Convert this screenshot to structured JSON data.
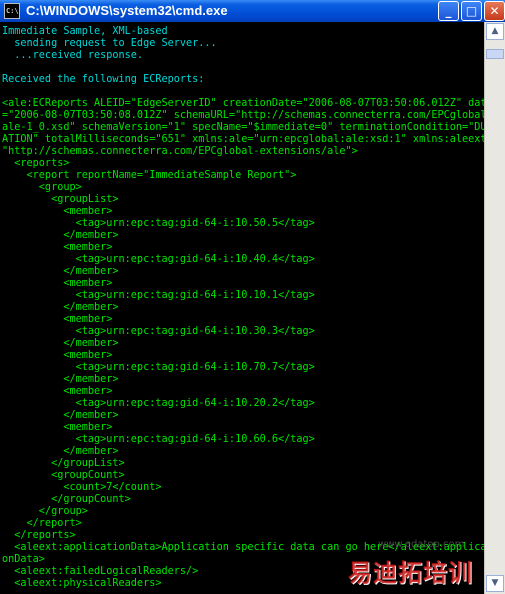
{
  "window": {
    "title": "C:\\WINDOWS\\system32\\cmd.exe",
    "icon_text": "C:\\",
    "buttons": {
      "minimize": "_",
      "maximize": "□",
      "close": "✕"
    }
  },
  "console": {
    "lines": [
      {
        "text": "Immediate Sample, XML-based",
        "color": "#00d8d8"
      },
      {
        "text": "  sending request to Edge Server...",
        "color": "#00d8d8"
      },
      {
        "text": "  ...received response.",
        "color": "#00d8d8"
      },
      {
        "text": "",
        "color": "#c0c0c0"
      },
      {
        "text": "Received the following ECReports:",
        "color": "#00d8d8"
      },
      {
        "text": "",
        "color": "#c0c0c0"
      },
      {
        "text": "<ale:ECReports ALEID=\"EdgeServerID\" creationDate=\"2006-08-07T03:50:06.012Z\" date",
        "color": "#00e400"
      },
      {
        "text": "=\"2006-08-07T03:50:08.012Z\" schemaURL=\"http://schemas.connecterra.com/EPCglobal/",
        "color": "#00e400"
      },
      {
        "text": "ale-1_0.xsd\" schemaVersion=\"1\" specName=\"$immediate=0\" terminationCondition=\"DUR",
        "color": "#00e400"
      },
      {
        "text": "ATION\" totalMilliseconds=\"651\" xmlns:ale=\"urn:epcglobal:ale:xsd:1\" xmlns:aleext=",
        "color": "#00e400"
      },
      {
        "text": "\"http://schemas.connecterra.com/EPCglobal-extensions/ale\">",
        "color": "#00e400"
      },
      {
        "text": "  <reports>",
        "color": "#00e400"
      },
      {
        "text": "    <report reportName=\"ImmediateSample Report\">",
        "color": "#00e400"
      },
      {
        "text": "      <group>",
        "color": "#00e400"
      },
      {
        "text": "        <groupList>",
        "color": "#00e400"
      },
      {
        "text": "          <member>",
        "color": "#00e400"
      },
      {
        "text": "            <tag>urn:epc:tag:gid-64-i:10.50.5</tag>",
        "color": "#00e400"
      },
      {
        "text": "          </member>",
        "color": "#00e400"
      },
      {
        "text": "          <member>",
        "color": "#00e400"
      },
      {
        "text": "            <tag>urn:epc:tag:gid-64-i:10.40.4</tag>",
        "color": "#00e400"
      },
      {
        "text": "          </member>",
        "color": "#00e400"
      },
      {
        "text": "          <member>",
        "color": "#00e400"
      },
      {
        "text": "            <tag>urn:epc:tag:gid-64-i:10.10.1</tag>",
        "color": "#00e400"
      },
      {
        "text": "          </member>",
        "color": "#00e400"
      },
      {
        "text": "          <member>",
        "color": "#00e400"
      },
      {
        "text": "            <tag>urn:epc:tag:gid-64-i:10.30.3</tag>",
        "color": "#00e400"
      },
      {
        "text": "          </member>",
        "color": "#00e400"
      },
      {
        "text": "          <member>",
        "color": "#00e400"
      },
      {
        "text": "            <tag>urn:epc:tag:gid-64-i:10.70.7</tag>",
        "color": "#00e400"
      },
      {
        "text": "          </member>",
        "color": "#00e400"
      },
      {
        "text": "          <member>",
        "color": "#00e400"
      },
      {
        "text": "            <tag>urn:epc:tag:gid-64-i:10.20.2</tag>",
        "color": "#00e400"
      },
      {
        "text": "          </member>",
        "color": "#00e400"
      },
      {
        "text": "          <member>",
        "color": "#00e400"
      },
      {
        "text": "            <tag>urn:epc:tag:gid-64-i:10.60.6</tag>",
        "color": "#00e400"
      },
      {
        "text": "          </member>",
        "color": "#00e400"
      },
      {
        "text": "        </groupList>",
        "color": "#00e400"
      },
      {
        "text": "        <groupCount>",
        "color": "#00e400"
      },
      {
        "text": "          <count>7</count>",
        "color": "#00e400"
      },
      {
        "text": "        </groupCount>",
        "color": "#00e400"
      },
      {
        "text": "      </group>",
        "color": "#00e400"
      },
      {
        "text": "    </report>",
        "color": "#00e400"
      },
      {
        "text": "  </reports>",
        "color": "#00e400"
      },
      {
        "text": "  <aleext:applicationData>Application specific data can go here</aleext:applicati",
        "color": "#00e400"
      },
      {
        "text": "onData>",
        "color": "#00e400"
      },
      {
        "text": "  <aleext:failedLogicalReaders/>",
        "color": "#00e400"
      },
      {
        "text": "  <aleext:physicalReaders>",
        "color": "#00e400"
      }
    ]
  },
  "watermark": {
    "text": "易迪拓培训",
    "url": "www.edatop.com"
  }
}
